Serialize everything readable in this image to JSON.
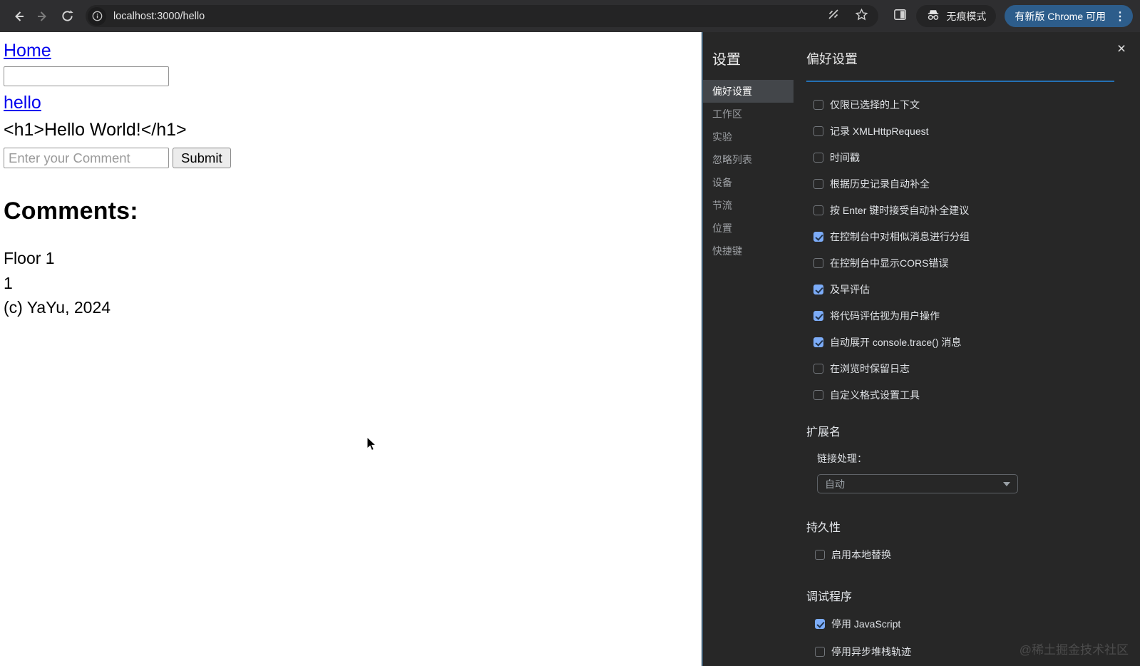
{
  "browser": {
    "url": "localhost:3000/hello",
    "incognito_label": "无痕模式",
    "update_chip_label": "有新版 Chrome 可用",
    "update_chip_color": "#2d5d8b"
  },
  "page": {
    "home_link": "Home",
    "top_input_value": "",
    "hello_link": "hello",
    "raw_html_text": "<h1>Hello World!</h1>",
    "comment_placeholder": "Enter your Comment",
    "submit_label": "Submit",
    "comments_heading": "Comments:",
    "comment_lines": [
      "Floor 1",
      "1",
      "(c) YaYu, 2024"
    ]
  },
  "devtools": {
    "sidebar": {
      "title": "设置",
      "items": [
        {
          "label": "偏好设置",
          "selected": true
        },
        {
          "label": "工作区",
          "selected": false
        },
        {
          "label": "实验",
          "selected": false
        },
        {
          "label": "忽略列表",
          "selected": false
        },
        {
          "label": "设备",
          "selected": false
        },
        {
          "label": "节流",
          "selected": false
        },
        {
          "label": "位置",
          "selected": false
        },
        {
          "label": "快捷键",
          "selected": false
        }
      ]
    },
    "panel": {
      "title": "偏好设置",
      "accent_underline_color": "#2470b4",
      "checkbox_checked_color": "#7cacf8",
      "checkboxes": [
        {
          "label": "仅限已选择的上下文",
          "checked": false
        },
        {
          "label": "记录 XMLHttpRequest",
          "checked": false
        },
        {
          "label": "时间戳",
          "checked": false
        },
        {
          "label": "根据历史记录自动补全",
          "checked": false
        },
        {
          "label": "按 Enter 键时接受自动补全建议",
          "checked": false
        },
        {
          "label": "在控制台中对相似消息进行分组",
          "checked": true
        },
        {
          "label": "在控制台中显示CORS错误",
          "checked": false
        },
        {
          "label": "及早评估",
          "checked": true
        },
        {
          "label": "将代码评估视为用户操作",
          "checked": true
        },
        {
          "label": "自动展开 console.trace() 消息",
          "checked": true
        },
        {
          "label": "在浏览时保留日志",
          "checked": false
        },
        {
          "label": "自定义格式设置工具",
          "checked": false
        }
      ],
      "extensions_section": {
        "title": "扩展名",
        "link_handling_label": "链接处理：",
        "link_handling_value": "自动"
      },
      "persistence_section": {
        "title": "持久性",
        "checkboxes": [
          {
            "label": "启用本地替换",
            "checked": false
          }
        ]
      },
      "debugger_section": {
        "title": "调试程序",
        "checkboxes": [
          {
            "label": "停用 JavaScript",
            "checked": true
          },
          {
            "label": "停用异步堆栈轨迹",
            "checked": false
          }
        ]
      },
      "close_label": "×"
    }
  },
  "watermark": "@稀土掘金技术社区"
}
